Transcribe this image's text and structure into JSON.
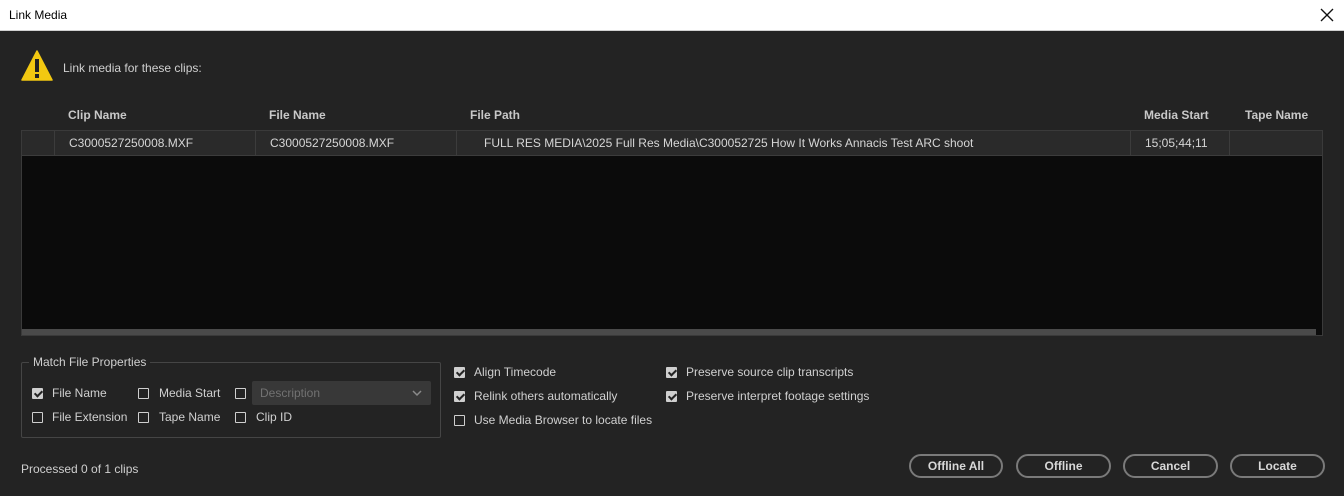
{
  "window": {
    "title": "Link Media"
  },
  "prompt": "Link media for these clips:",
  "columns": [
    "Clip Name",
    "File Name",
    "File Path",
    "Media Start",
    "Tape Name"
  ],
  "rows": [
    {
      "clip_name": "C3000527250008.MXF",
      "file_name": "C3000527250008.MXF",
      "file_path": "FULL RES MEDIA\\2025 Full Res Media\\C300052725 How It Works Annacis Test ARC shoot",
      "media_start": "15;05;44;11",
      "tape_name": ""
    }
  ],
  "match_props": {
    "legend": "Match File Properties",
    "file_name": {
      "label": "File Name",
      "checked": true
    },
    "media_start": {
      "label": "Media Start",
      "checked": false
    },
    "description": {
      "placeholder": "Description",
      "checked": false
    },
    "file_extension": {
      "label": "File Extension",
      "checked": false
    },
    "tape_name": {
      "label": "Tape Name",
      "checked": false
    },
    "clip_id": {
      "label": "Clip ID",
      "checked": false
    }
  },
  "options": {
    "align_timecode": {
      "label": "Align Timecode",
      "checked": true
    },
    "relink_others": {
      "label": "Relink others automatically",
      "checked": true
    },
    "use_media_browser": {
      "label": "Use Media Browser to locate files",
      "checked": false
    },
    "preserve_transcripts": {
      "label": "Preserve source clip transcripts",
      "checked": true
    },
    "preserve_interpret": {
      "label": "Preserve interpret footage settings",
      "checked": true
    }
  },
  "status": "Processed 0 of 1 clips",
  "buttons": {
    "offline_all": "Offline All",
    "offline": "Offline",
    "cancel": "Cancel",
    "locate": "Locate"
  },
  "colors": {
    "warning": "#f2c811",
    "background": "#232323",
    "table_bg": "#0b0b0b"
  }
}
